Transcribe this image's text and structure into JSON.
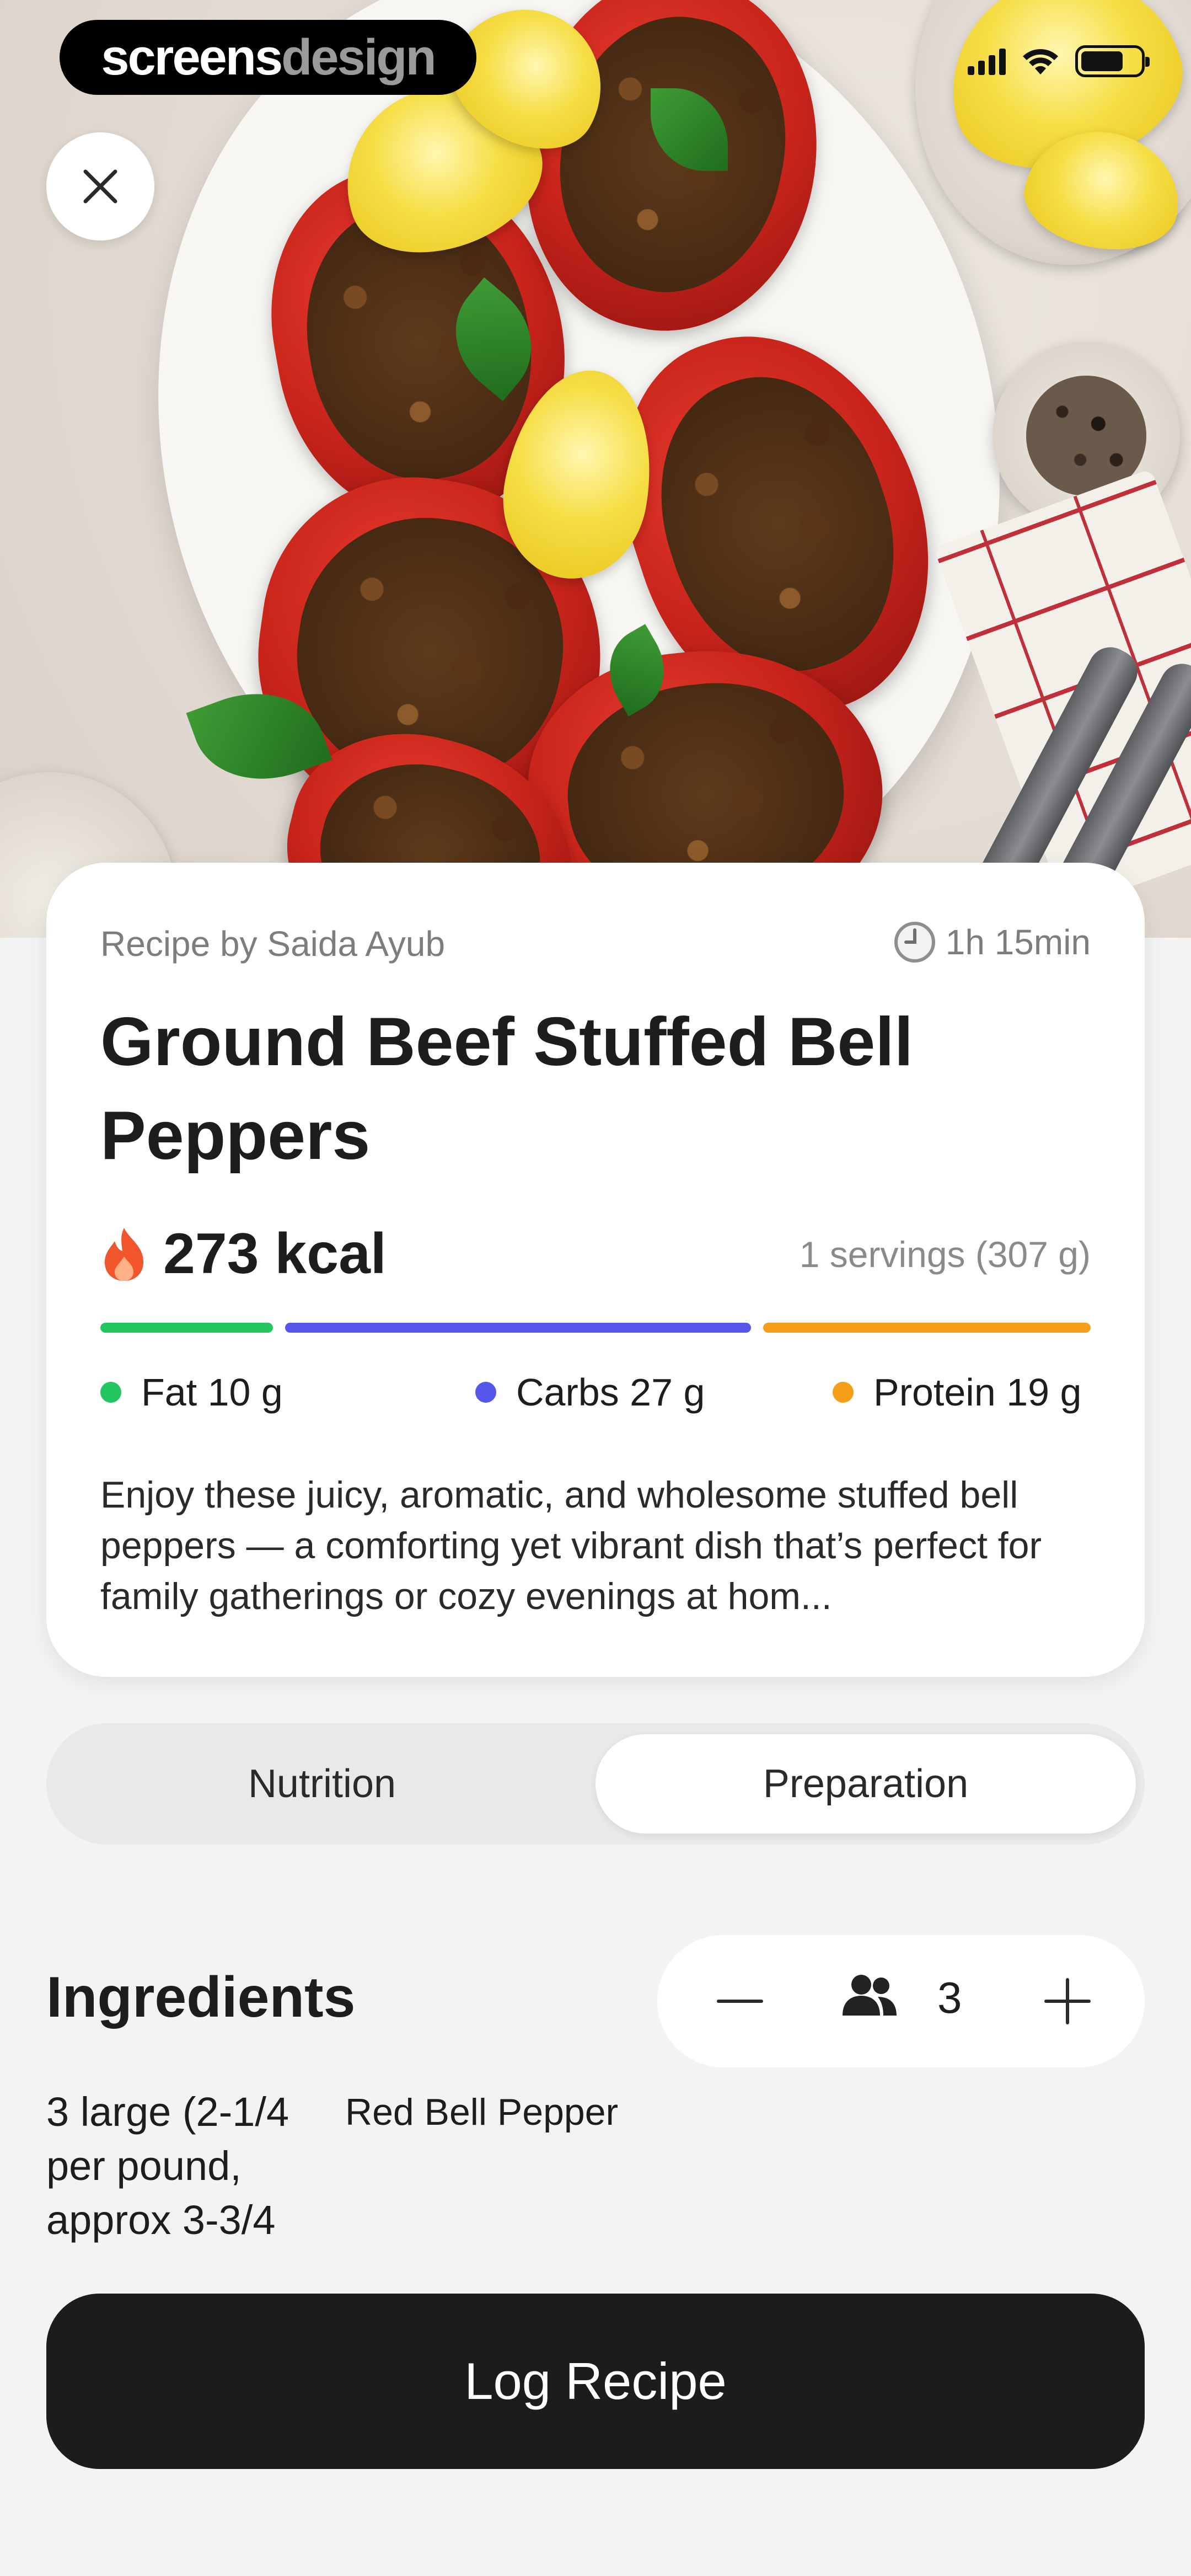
{
  "status_bar": {
    "brand_part1": "screens",
    "brand_part2": "design"
  },
  "hero": {
    "image": "stuffed-bell-peppers-photo"
  },
  "recipe": {
    "byline": "Recipe by Saida Ayub",
    "time": "1h 15min",
    "title": "Ground Beef Stuffed Bell Peppers",
    "kcal": "273 kcal",
    "servings": "1 servings (307 g)",
    "macros": [
      {
        "label": "Fat 10 g",
        "color": "#22c55e",
        "grams": 10
      },
      {
        "label": "Carbs 27 g",
        "color": "#5557ea",
        "grams": 27
      },
      {
        "label": "Protein 19 g",
        "color": "#f59e1a",
        "grams": 19
      }
    ],
    "description": "Enjoy these juicy, aromatic, and wholesome stuffed bell peppers — a comforting yet vibrant dish that’s perfect for family gatherings or cozy evenings at hom..."
  },
  "tabs": [
    {
      "label": "Nutrition",
      "active": false
    },
    {
      "label": "Preparation",
      "active": true
    }
  ],
  "ingredients": {
    "title": "Ingredients",
    "servings_count": "3",
    "items": [
      {
        "quantity": "3 large (2-1/4 per pound, approx 3-3/4",
        "name": "Red Bell Pepper"
      }
    ]
  },
  "cta": {
    "label": "Log Recipe"
  },
  "colors": {
    "accent_dark": "#1c1c1e",
    "fat": "#22c55e",
    "carbs": "#5557ea",
    "protein": "#f59e1a",
    "flame": "#f0552b"
  }
}
